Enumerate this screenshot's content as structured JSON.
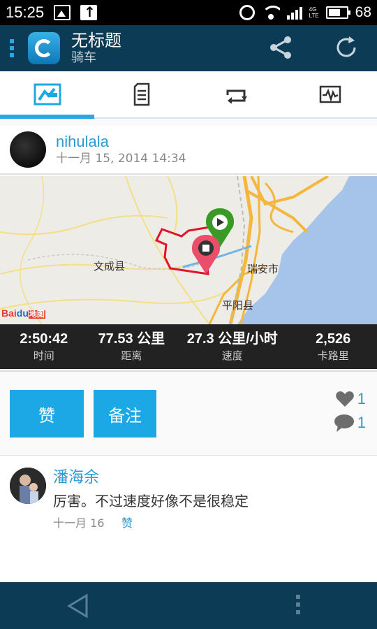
{
  "status_bar": {
    "time": "15:25",
    "lte": "4G LTE",
    "battery_percent": "68",
    "battery_level": 0.68
  },
  "app_bar": {
    "title": "无标题",
    "subtitle": "骑车"
  },
  "tabs": [
    {
      "icon": "map-tab-icon",
      "active": true
    },
    {
      "icon": "document-tab-icon",
      "active": false
    },
    {
      "icon": "repeat-tab-icon",
      "active": false
    },
    {
      "icon": "chart-tab-icon",
      "active": false
    }
  ],
  "activity": {
    "user": "nihulala",
    "date": "十一月 15, 2014 14:34"
  },
  "map": {
    "labels": {
      "wencheng": "文成县",
      "ruian": "瑞安市",
      "pingyang": "平阳县"
    },
    "provider": {
      "bai": "Bai",
      "du": "du",
      "suffix": "地图"
    },
    "colors": {
      "route": "#e3122a",
      "start_pin": "#3a9a26",
      "end_pin": "#ea4e6a",
      "sea": "#a6c4ea"
    }
  },
  "stats": [
    {
      "value": "2:50:42",
      "label": "时间"
    },
    {
      "value": "77.53 公里",
      "label": "距离"
    },
    {
      "value": "27.3 公里/小时",
      "label": "速度"
    },
    {
      "value": "2,526",
      "label": "卡路里"
    }
  ],
  "actions": {
    "like_label": "赞",
    "note_label": "备注",
    "likes_count": "1",
    "comments_count": "1"
  },
  "comment": {
    "author": "潘海余",
    "text": "厉害。不过速度好像不是很稳定",
    "date": "十一月 16",
    "like_label": "赞"
  },
  "colors": {
    "accent": "#1ba8e4",
    "appbar": "#0c3b55",
    "link": "#2a9ad4"
  }
}
